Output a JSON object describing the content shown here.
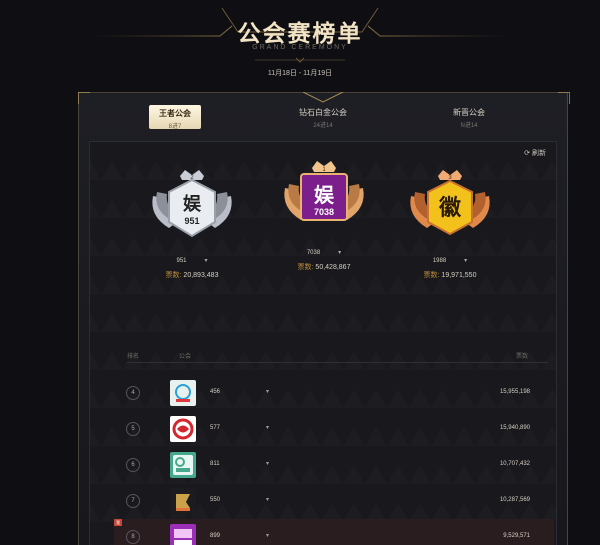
{
  "header": {
    "title": "公会赛榜单",
    "subtitle": "GRAND CEREMONY",
    "date_range": "11月18日 - 11月19日"
  },
  "tabs": [
    {
      "label": "王者公会",
      "sub": "8进7"
    },
    {
      "label": "钻石白金公会",
      "sub": "24进14"
    },
    {
      "label": "新晋公会",
      "sub": "N进14"
    }
  ],
  "refresh_label": "刷新",
  "podium": [
    {
      "place": "2",
      "guild_id": "951",
      "score_label": "票数:",
      "score": "20,893,483",
      "badge_text": "娱",
      "badge_num": "951"
    },
    {
      "place": "1",
      "guild_id": "7038",
      "score_label": "票数:",
      "score": "50,428,867",
      "badge_text": "娱",
      "badge_num": "7038"
    },
    {
      "place": "3",
      "guild_id": "1988",
      "score_label": "票数:",
      "score": "19,971,550",
      "badge_text": "徽",
      "badge_num": ""
    }
  ],
  "list_header": {
    "rank": "排名",
    "guild": "公会",
    "score": "票数"
  },
  "rows": [
    {
      "rank": "4",
      "guild_id": "456",
      "score": "15,955,198",
      "logo_color": "#e9f1ef"
    },
    {
      "rank": "5",
      "guild_id": "577",
      "score": "15,940,890",
      "logo_color": "#ffffff"
    },
    {
      "rank": "6",
      "guild_id": "811",
      "score": "10,707,432",
      "logo_color": "#46a98e"
    },
    {
      "rank": "7",
      "guild_id": "550",
      "score": "10,287,569",
      "logo_color": "#1c1c1f"
    },
    {
      "rank": "8",
      "guild_id": "899",
      "score": "9,529,571",
      "logo_color": "#9b2fb8",
      "is_me": true,
      "me_label": "我"
    }
  ]
}
